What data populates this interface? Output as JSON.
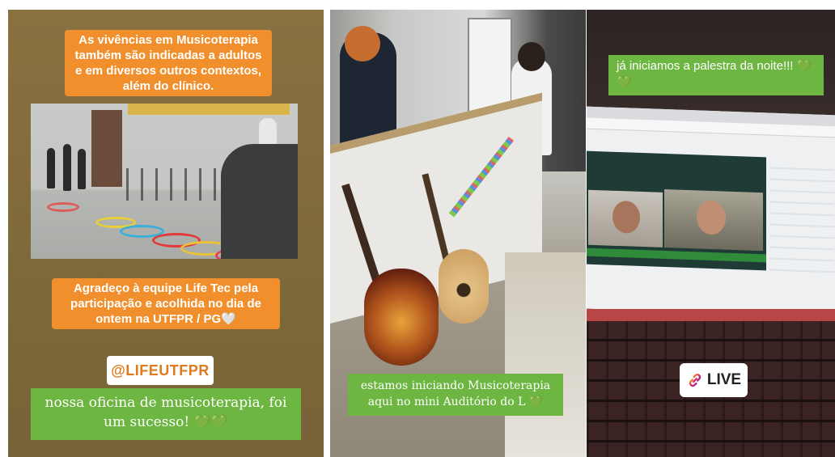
{
  "panel1": {
    "caption_top": "As vivências em Musicoterapia também são indicadas a adultos e em diversos outros contextos, além do clínico.",
    "caption_middle": "Agradeço à equipe Life Tec pela participação e acolhida no dia de ontem na UTFPR / PG🤍",
    "mention_tag": "@LIFEUTFPR",
    "green_caption": "nossa oficina de musicoterapia, foi um sucesso! 💚💚"
  },
  "panel2": {
    "green_caption": "estamos iniciando Musicoterapia aqui no mini Auditório do L 💚"
  },
  "panel3": {
    "green_caption": "já iniciamos a palestra da noite!!! 💚💚",
    "live_label": "LIVE"
  },
  "colors": {
    "orange": "#f08f2c",
    "green": "#6db642"
  },
  "icons": {
    "live": "link-icon"
  }
}
